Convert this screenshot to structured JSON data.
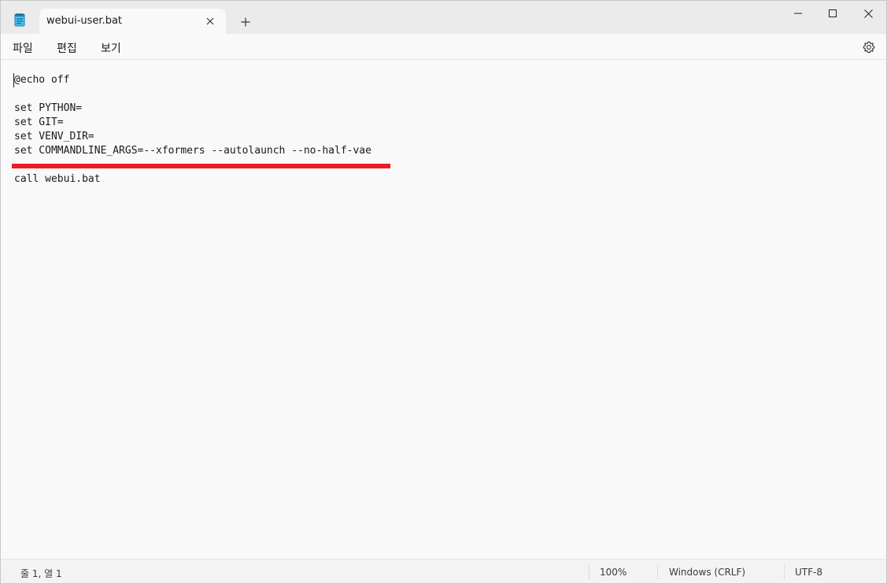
{
  "window": {
    "tab_title": "webui-user.bat",
    "app_icon": "notepad-icon",
    "close_tab_icon": "close-icon",
    "new_tab_icon": "plus-icon",
    "controls": [
      "minimize-icon",
      "maximize-icon",
      "close-icon"
    ]
  },
  "menu": {
    "file": "파일",
    "edit": "편집",
    "view": "보기",
    "settings_icon": "gear-icon"
  },
  "editor": {
    "lines": [
      "@echo off",
      "",
      "set PYTHON=",
      "set GIT=",
      "set VENV_DIR=",
      "set COMMANDLINE_ARGS=--xformers --autolaunch --no-half-vae",
      "",
      "call webui.bat"
    ],
    "annotation_color": "#ec1c24"
  },
  "status": {
    "position": "줄 1, 열 1",
    "zoom": "100%",
    "line_ending": "Windows (CRLF)",
    "encoding": "UTF-8"
  }
}
